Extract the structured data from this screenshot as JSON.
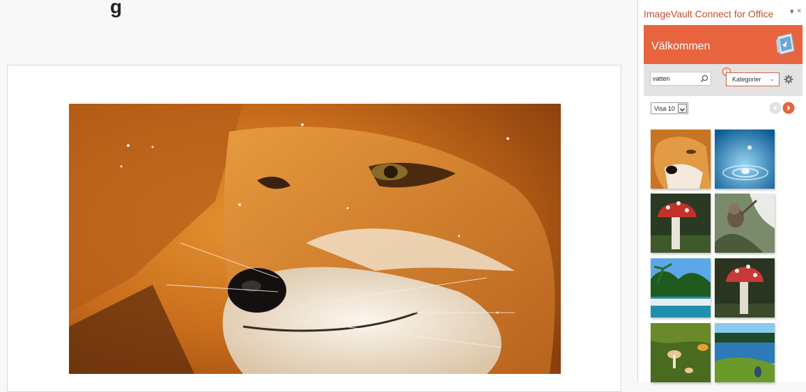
{
  "document": {
    "title_fragment": "g"
  },
  "task_pane": {
    "title": "ImageVault Connect for Office",
    "menu_glyph": "▾",
    "close_glyph": "×",
    "banner": {
      "text": "Välkommen",
      "color": "#e8643e"
    },
    "search": {
      "value": "vatten",
      "icon": "search-icon"
    },
    "category": {
      "badge": "1",
      "selected": "Kategorier",
      "icon": "chevron-down-icon"
    },
    "settings": {
      "icon": "gear-icon"
    },
    "page_size": {
      "selected": "Visa 10"
    },
    "pager": {
      "prev_icon": "arrow-left-icon",
      "next_icon": "arrow-right-icon",
      "accent": "#e8643e"
    },
    "thumbnails": [
      {
        "subject": "fox"
      },
      {
        "subject": "water-drop"
      },
      {
        "subject": "red-mushroom"
      },
      {
        "subject": "monkey"
      },
      {
        "subject": "palm-beach"
      },
      {
        "subject": "red-mushroom-2"
      },
      {
        "subject": "small-mushrooms"
      },
      {
        "subject": "lake-meadow"
      }
    ]
  }
}
